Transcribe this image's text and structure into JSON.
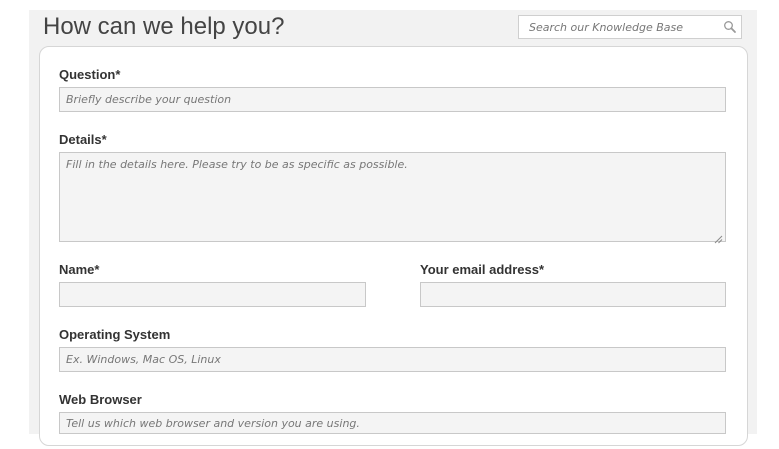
{
  "header": {
    "title": "How can we help you?",
    "search_placeholder": "Search our Knowledge Base",
    "search_icon": "magnifier-icon"
  },
  "form": {
    "question": {
      "label": "Question*",
      "placeholder": "Briefly describe your question"
    },
    "details": {
      "label": "Details*",
      "placeholder": "Fill in the details here. Please try to be as specific as possible."
    },
    "name": {
      "label": "Name*",
      "placeholder": ""
    },
    "email": {
      "label": "Your email address*",
      "placeholder": ""
    },
    "os": {
      "label": "Operating System",
      "placeholder": "Ex. Windows, Mac OS, Linux"
    },
    "browser": {
      "label": "Web Browser",
      "placeholder": "Tell us which web browser and version you are using."
    }
  }
}
